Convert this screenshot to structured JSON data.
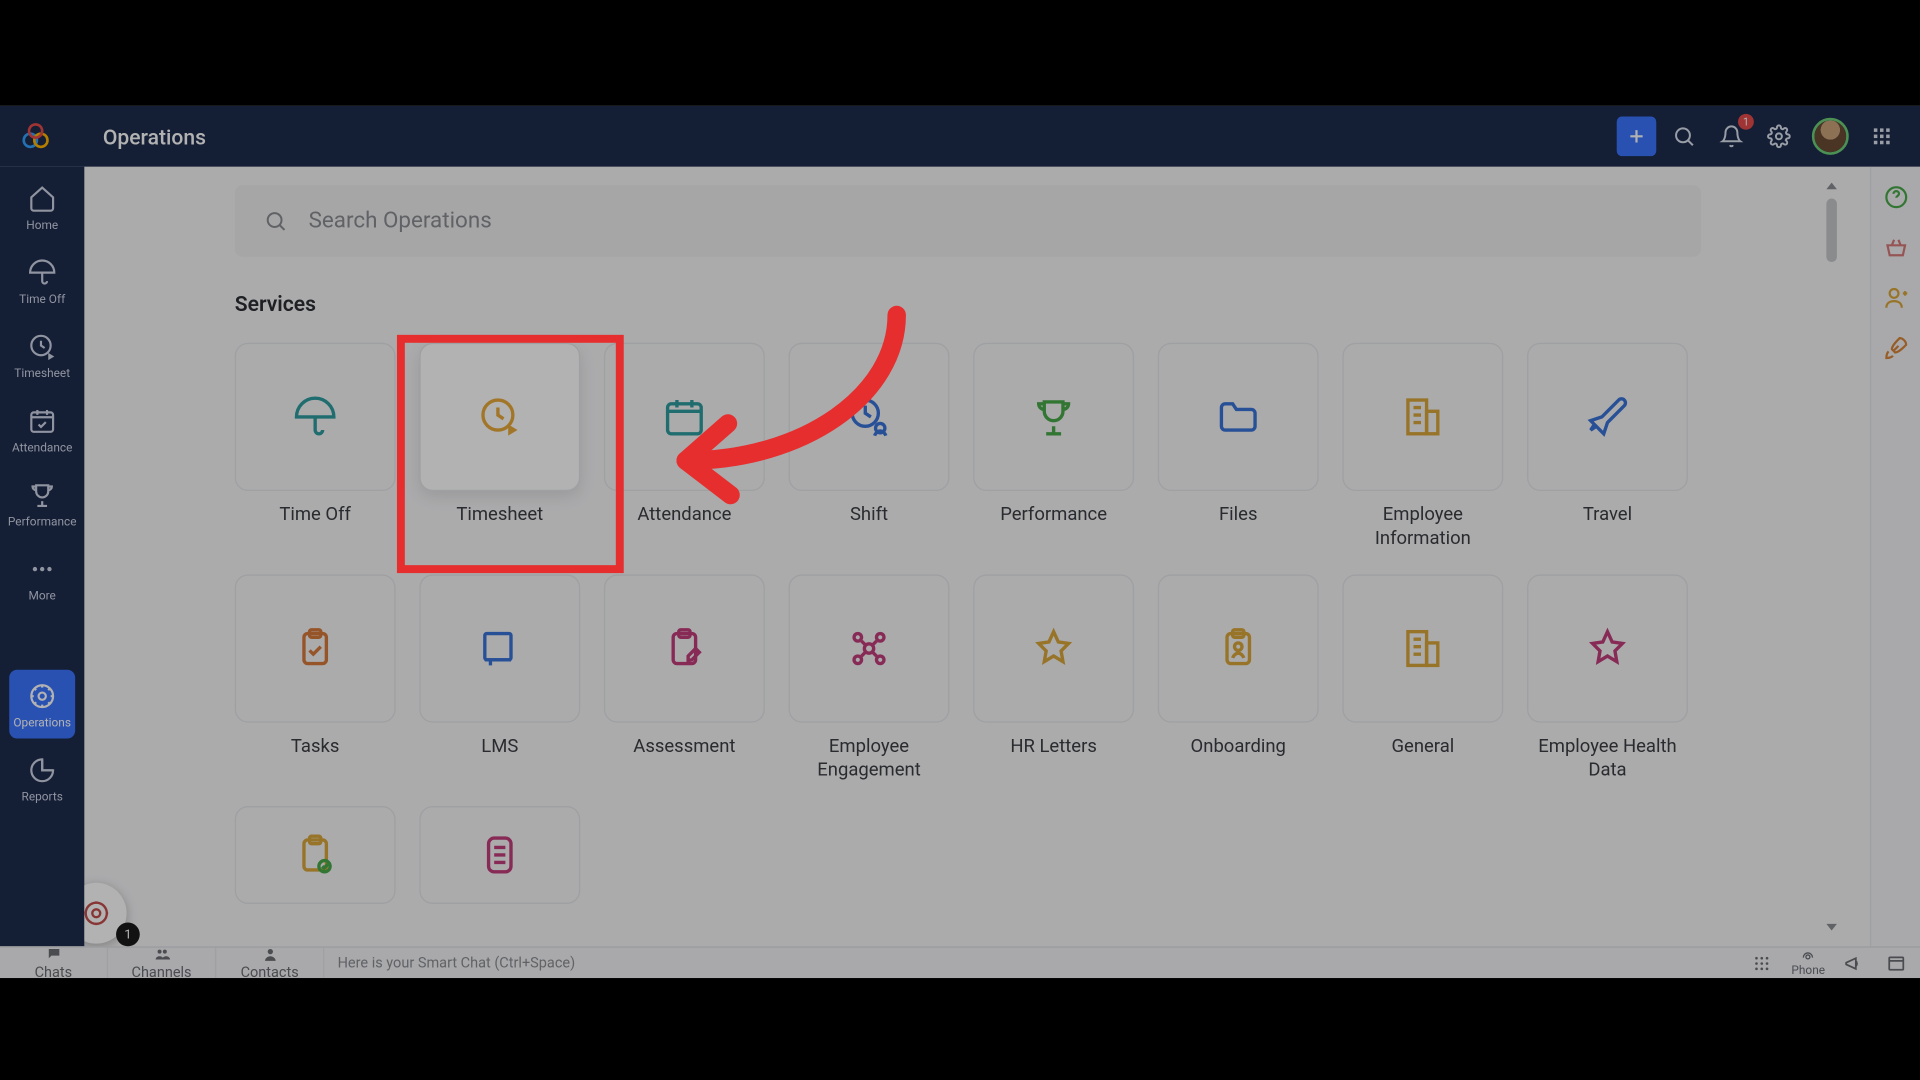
{
  "header": {
    "title": "Operations",
    "notification_count": "1"
  },
  "sidebar": {
    "items": [
      {
        "label": "Home"
      },
      {
        "label": "Time Off"
      },
      {
        "label": "Timesheet"
      },
      {
        "label": "Attendance"
      },
      {
        "label": "Performance"
      },
      {
        "label": "More"
      },
      {
        "label": "Operations"
      },
      {
        "label": "Reports"
      }
    ]
  },
  "search": {
    "placeholder": "Search Operations"
  },
  "section": {
    "title": "Services"
  },
  "tiles": {
    "row1": [
      {
        "label": "Time Off"
      },
      {
        "label": "Timesheet"
      },
      {
        "label": "Attendance"
      },
      {
        "label": "Shift"
      },
      {
        "label": "Performance"
      },
      {
        "label": "Files"
      },
      {
        "label": "Employee Information"
      },
      {
        "label": "Travel"
      }
    ],
    "row2": [
      {
        "label": "Tasks"
      },
      {
        "label": "LMS"
      },
      {
        "label": "Assessment"
      },
      {
        "label": "Employee Engagement"
      },
      {
        "label": "HR Letters"
      },
      {
        "label": "Onboarding"
      },
      {
        "label": "General"
      },
      {
        "label": "Employee Health Data"
      }
    ]
  },
  "bottombar": {
    "tabs": [
      {
        "label": "Chats"
      },
      {
        "label": "Channels"
      },
      {
        "label": "Contacts"
      }
    ],
    "chat_placeholder": "Here is your Smart Chat (Ctrl+Space)",
    "phone_label": "Phone"
  },
  "fab": {
    "badge": "1"
  }
}
